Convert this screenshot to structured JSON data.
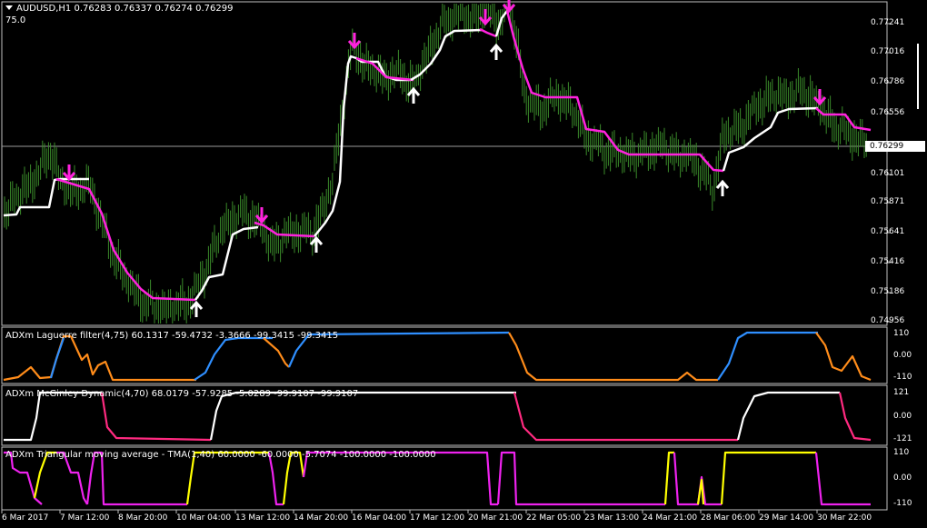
{
  "main": {
    "symbol": "AUDUSD,H1",
    "ohlc": "0.76283 0.76337 0.76274 0.76299",
    "level": "75.0",
    "current_price": "0.76299",
    "price_ticks": [
      "0.77241",
      "0.77016",
      "0.76786",
      "0.76556",
      "0.76299",
      "0.76101",
      "0.75871",
      "0.75641",
      "0.75416",
      "0.75186",
      "0.74956"
    ]
  },
  "panels": [
    {
      "label": "ADXm Laguerre filter(4,75) 60.1317 -59.4732 -3.3666 -99.3415 -99.3415",
      "ticks": [
        "110",
        "0.00",
        "-110"
      ]
    },
    {
      "label": "ADXm McGinley Dynamic(4,70) 68.0179 -57.9285 -5.0289 -99.9107 -99.9107",
      "ticks": [
        "121",
        "0.00",
        "-121"
      ]
    },
    {
      "label": "ADXm Triangular moving average - TMA(1,40) 60.0000 -60.0000 -5.7074 -100.0000 -100.0000",
      "ticks": [
        "110",
        "0.00",
        "-110"
      ]
    }
  ],
  "time_ticks": [
    "6 Mar 2017",
    "7 Mar 12:00",
    "8 Mar 20:00",
    "10 Mar 04:00",
    "13 Mar 12:00",
    "14 Mar 20:00",
    "16 Mar 04:00",
    "17 Mar 12:00",
    "20 Mar 21:00",
    "22 Mar 05:00",
    "23 Mar 13:00",
    "24 Mar 21:00",
    "28 Mar 06:00",
    "29 Mar 14:00",
    "30 Mar 22:00"
  ],
  "colors": {
    "background": "#000000",
    "candles": "#3a8a2a",
    "ma_up": "#ffffff",
    "ma_down": "#ff22dd",
    "arrow_up": "#ffffff",
    "arrow_down": "#ff22dd",
    "laguerre_up": "#2f8fff",
    "laguerre_down": "#ff8c1a",
    "mcginley_up": "#ffffff",
    "mcginley_down": "#ff2a80",
    "tma_up": "#ffff00",
    "tma_down": "#ee22ee",
    "grid": "#c0c0c0"
  }
}
